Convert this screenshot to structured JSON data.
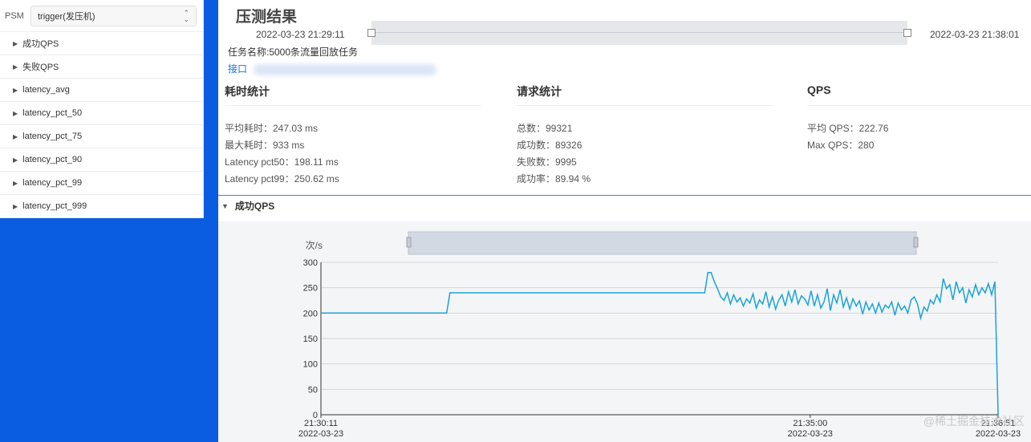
{
  "sidebar": {
    "psm_label": "PSM",
    "psm_value": "trigger(发压机)",
    "items": [
      {
        "label": "成功QPS"
      },
      {
        "label": "失败QPS"
      },
      {
        "label": "latency_avg"
      },
      {
        "label": "latency_pct_50"
      },
      {
        "label": "latency_pct_75"
      },
      {
        "label": "latency_pct_90"
      },
      {
        "label": "latency_pct_99"
      },
      {
        "label": "latency_pct_999"
      }
    ]
  },
  "header": {
    "title": "压测结果",
    "time_start": "2022-03-23 21:29:11",
    "time_end": "2022-03-23 21:38:01",
    "task_name": "任务名称:5000条流量回放任务",
    "interface_label": "接口"
  },
  "stats": {
    "latency": {
      "title": "耗时统计",
      "lines": [
        "平均耗时：247.03 ms",
        "最大耗时：933 ms",
        "Latency pct50：198.11 ms",
        "Latency pct99：250.62 ms"
      ]
    },
    "requests": {
      "title": "请求统计",
      "lines": [
        "总数：99321",
        "成功数：89326",
        "失败数：9995",
        "成功率：89.94 %"
      ]
    },
    "qps": {
      "title": "QPS",
      "lines": [
        "平均 QPS：222.76",
        "Max QPS：280"
      ]
    }
  },
  "section": {
    "title": "成功QPS"
  },
  "watermark": "@稀土掘金技术社区",
  "chart_data": {
    "type": "line",
    "ylabel": "次/s",
    "ylim": [
      0,
      300
    ],
    "yticks": [
      "300",
      "250",
      "200",
      "150",
      "100",
      "50",
      "0"
    ],
    "xticks": [
      {
        "time": "21:30:11",
        "date": "2022-03-23"
      },
      {
        "time": "21:35:00",
        "date": "2022-03-23"
      },
      {
        "time": "21:36:51",
        "date": "2022-03-23"
      }
    ],
    "series": [
      {
        "color": "#1aa3d6",
        "values": [
          200,
          200,
          200,
          200,
          200,
          200,
          200,
          200,
          200,
          200,
          200,
          200,
          200,
          200,
          200,
          200,
          200,
          200,
          200,
          200,
          200,
          200,
          200,
          200,
          200,
          200,
          200,
          200,
          200,
          200,
          200,
          200,
          200,
          200,
          200,
          200,
          200,
          200,
          200,
          200,
          240,
          240,
          240,
          240,
          240,
          240,
          240,
          240,
          240,
          240,
          240,
          240,
          240,
          240,
          240,
          240,
          240,
          240,
          240,
          240,
          240,
          240,
          240,
          240,
          240,
          240,
          240,
          240,
          240,
          240,
          240,
          240,
          240,
          240,
          240,
          240,
          240,
          240,
          240,
          240,
          240,
          240,
          240,
          240,
          240,
          240,
          240,
          240,
          240,
          240,
          240,
          240,
          240,
          240,
          240,
          240,
          240,
          240,
          240,
          240,
          240,
          240,
          240,
          240,
          240,
          240,
          240,
          240,
          240,
          240,
          240,
          240,
          240,
          240,
          240,
          240,
          240,
          240,
          240,
          240,
          280,
          280,
          262,
          248,
          232,
          225,
          240,
          218,
          236,
          222,
          230,
          214,
          228,
          220,
          238,
          210,
          226,
          218,
          242,
          212,
          232,
          208,
          226,
          236,
          214,
          242,
          222,
          246,
          218,
          234,
          228,
          216,
          244,
          214,
          236,
          210,
          222,
          248,
          205,
          236,
          220,
          246,
          212,
          230,
          208,
          228,
          214,
          224,
          198,
          222,
          206,
          218,
          200,
          220,
          202,
          216,
          210,
          222,
          196,
          220,
          206,
          214,
          200,
          226,
          232,
          218,
          190,
          212,
          204,
          226,
          218,
          236,
          222,
          268,
          248,
          256,
          226,
          262,
          240,
          250,
          220,
          246,
          232,
          256,
          236,
          250,
          240,
          258,
          236,
          262,
          0
        ]
      }
    ]
  }
}
